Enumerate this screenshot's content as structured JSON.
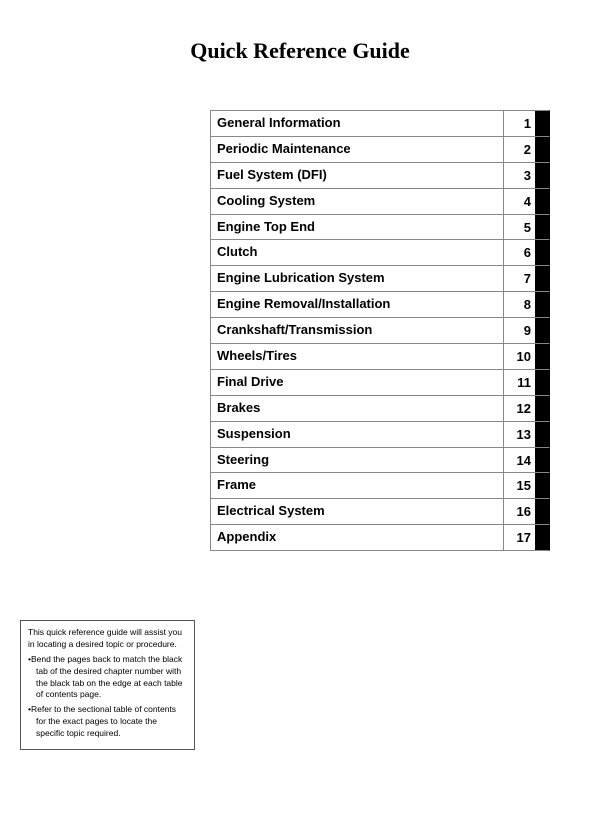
{
  "title": "Quick Reference Guide",
  "toc": {
    "items": [
      {
        "label": "General Information",
        "number": "1"
      },
      {
        "label": "Periodic Maintenance",
        "number": "2"
      },
      {
        "label": "Fuel System (DFI)",
        "number": "3"
      },
      {
        "label": "Cooling System",
        "number": "4"
      },
      {
        "label": "Engine Top End",
        "number": "5"
      },
      {
        "label": "Clutch",
        "number": "6"
      },
      {
        "label": "Engine Lubrication System",
        "number": "7"
      },
      {
        "label": "Engine Removal/Installation",
        "number": "8"
      },
      {
        "label": "Crankshaft/Transmission",
        "number": "9"
      },
      {
        "label": "Wheels/Tires",
        "number": "10"
      },
      {
        "label": "Final Drive",
        "number": "11"
      },
      {
        "label": "Brakes",
        "number": "12"
      },
      {
        "label": "Suspension",
        "number": "13"
      },
      {
        "label": "Steering",
        "number": "14"
      },
      {
        "label": "Frame",
        "number": "15"
      },
      {
        "label": "Electrical System",
        "number": "16"
      },
      {
        "label": "Appendix",
        "number": "17"
      }
    ]
  },
  "note": {
    "intro": "This quick reference guide will assist you in locating a desired topic or procedure.",
    "bullet1": "Bend the pages back to match the black tab of the desired chapter number with the black tab on the edge at each table of contents page.",
    "bullet2": "Refer to the sectional table of contents for the exact pages to locate the specific topic required."
  }
}
